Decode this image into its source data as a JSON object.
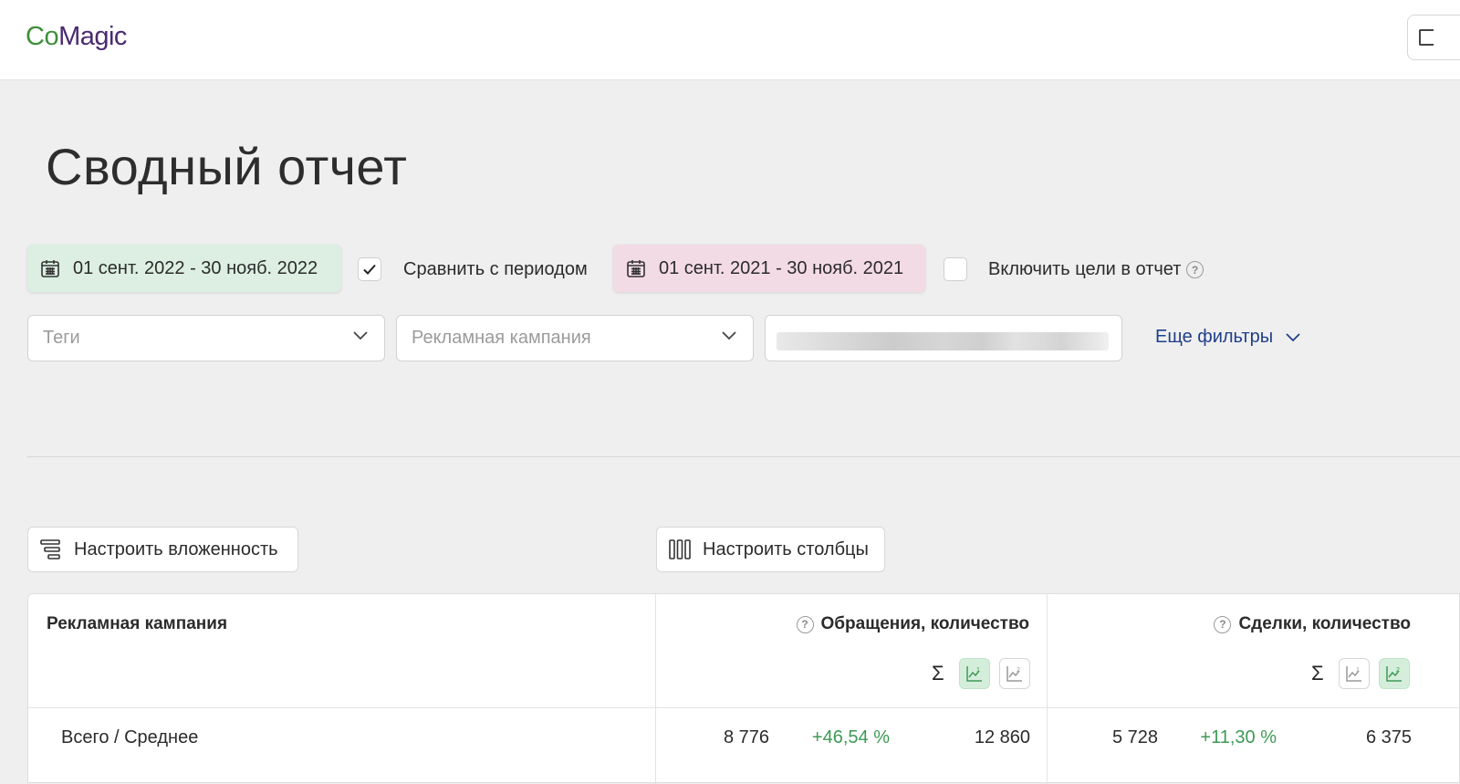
{
  "app": {
    "logo_part1": "Co",
    "logo_part2": "Magic",
    "brand_colors": {
      "green": "#3f8f3a",
      "purple": "#4b2a6e"
    }
  },
  "page": {
    "title": "Сводный отчет"
  },
  "period": {
    "main_range": "01 сент. 2022 - 30 нояб. 2022",
    "compare_checked": true,
    "compare_label": "Сравнить с периодом",
    "compare_range": "01 сент. 2021 - 30 нояб. 2021",
    "goals_checked": false,
    "goals_label": "Включить цели в отчет"
  },
  "filters": {
    "tags_placeholder": "Теги",
    "campaign_placeholder": "Рекламная кампания",
    "more_label": "Еще фильтры"
  },
  "toolbar": {
    "nesting_label": "Настроить вложенность",
    "columns_label": "Настроить столбцы"
  },
  "table": {
    "first_column_header": "Рекламная кампания",
    "metrics": [
      {
        "name": "Обращения, количество",
        "active_mode": 1
      },
      {
        "name": "Сделки, количество",
        "active_mode": 2
      }
    ],
    "sigma": "Σ",
    "total_row": {
      "label": "Всего / Среднее",
      "appeals": {
        "current": "8 776",
        "delta": "+46,54 %",
        "previous": "12 860"
      },
      "deals": {
        "current": "5 728",
        "delta": "+11,30 %",
        "previous": "6 375"
      }
    }
  }
}
